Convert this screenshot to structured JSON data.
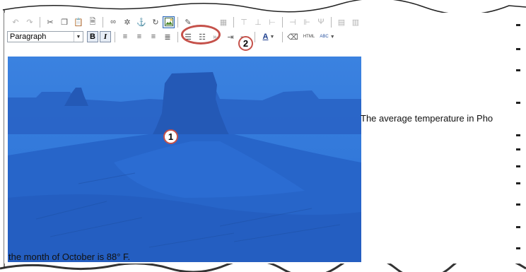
{
  "toolbar": {
    "format_select": {
      "value": "Paragraph"
    },
    "bold_label": "B",
    "italic_label": "I",
    "font_color_label": "A",
    "html_label": "HTML",
    "spell_label": "ABC"
  },
  "callouts": {
    "one": "1",
    "two": "2"
  },
  "content": {
    "text_right": "The average temperature in Pho",
    "text_bottom": "the month of October is 88° F."
  },
  "colors": {
    "image_tint": "#2a6fd4",
    "callout_ring": "#c5514a"
  }
}
